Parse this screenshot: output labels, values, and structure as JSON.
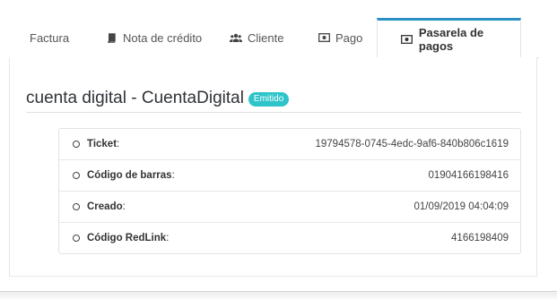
{
  "tabs": [
    {
      "label": "Factura",
      "icon": "none"
    },
    {
      "label": "Nota de crédito",
      "icon": "book-icon"
    },
    {
      "label": "Cliente",
      "icon": "users-icon"
    },
    {
      "label": "Pago",
      "icon": "money-icon"
    },
    {
      "label": "Pasarela de pagos",
      "icon": "money-icon",
      "active": true
    }
  ],
  "header": {
    "title": "cuenta digital - CuentaDigital",
    "badge": "Emitido",
    "badge_color": "#2ec4c9"
  },
  "details": [
    {
      "label": "Ticket",
      "value": "19794578-0745-4edc-9af6-840b806c1619"
    },
    {
      "label": "Código de barras",
      "value": "01904166198416"
    },
    {
      "label": "Creado",
      "value": "01/09/2019 04:04:09"
    },
    {
      "label": "Código RedLink",
      "value": "4166198409"
    }
  ],
  "colors": {
    "active_tab_accent": "#2a8fc7"
  }
}
